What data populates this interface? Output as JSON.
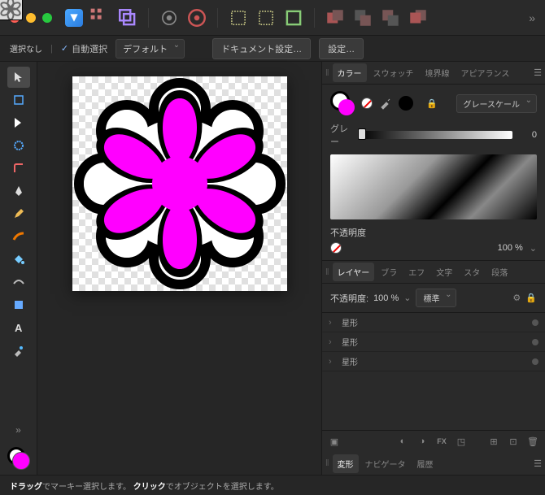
{
  "titlebar": {
    "more": "»"
  },
  "options": {
    "no_select": "選択なし",
    "auto_select": "自動選択",
    "preset": "デフォルト",
    "doc_settings": "ドキュメント設定…",
    "settings": "設定…"
  },
  "rp": {
    "tabs1": {
      "color": "カラー",
      "swatches": "スウォッチ",
      "stroke": "境界線",
      "appearance": "アピアランス"
    },
    "color": {
      "mode": "グレースケール",
      "grey_label": "グレー",
      "grey_value": "0",
      "opacity_label": "不透明度",
      "opacity_value": "100 %"
    },
    "tabs2": {
      "layers": "レイヤー",
      "brush": "ブラ",
      "effects": "エフ",
      "text": "文字",
      "styles": "スタ",
      "paragraph": "段落"
    },
    "layer_header": {
      "opacity_label": "不透明度:",
      "opacity_value": "100 %",
      "blend": "標準"
    },
    "layers": [
      {
        "name": "星形",
        "color": "#ff00ff",
        "fill": true
      },
      {
        "name": "星形",
        "color": "#ffffff",
        "fill": true
      },
      {
        "name": "星形",
        "color": "none",
        "fill": false
      }
    ],
    "tabs3": {
      "transform": "変形",
      "navigator": "ナビゲータ",
      "history": "履歴"
    }
  },
  "status": {
    "drag": "ドラッグ",
    "drag_txt": "でマーキー選択します。",
    "click": "クリック",
    "click_txt": "でオブジェクトを選択します。"
  }
}
